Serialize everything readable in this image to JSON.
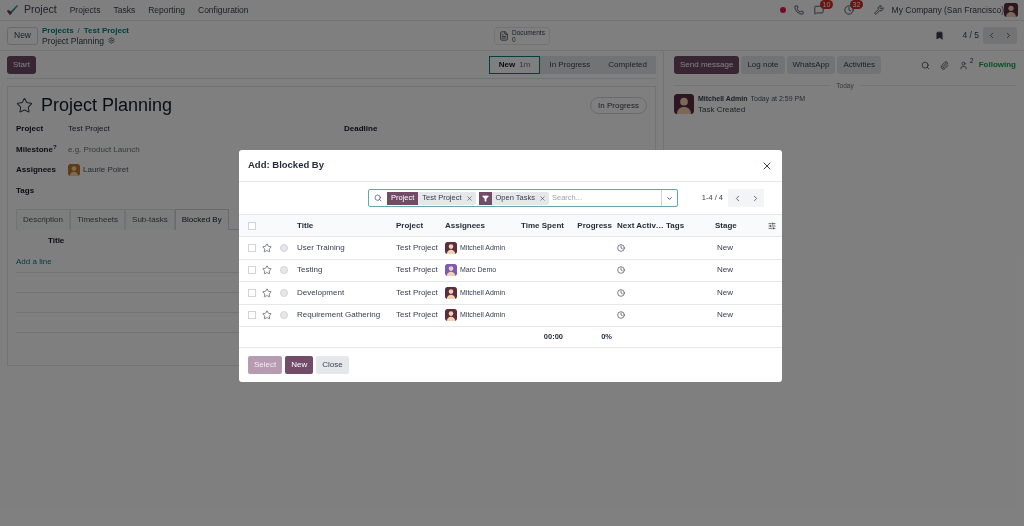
{
  "navbar": {
    "app": "Project",
    "menu": [
      "Projects",
      "Tasks",
      "Reporting",
      "Configuration"
    ],
    "messages_count": "10",
    "activities_count": "32",
    "company": "My Company (San Francisco)"
  },
  "control_panel": {
    "new_button": "New",
    "breadcrumbs": [
      "Projects",
      "Test Project"
    ],
    "separator": "/",
    "record": "Project Planning",
    "documents": {
      "label": "Documents",
      "count": "0"
    },
    "pager": "4 / 5"
  },
  "status_bar": {
    "start": "Start",
    "stages": [
      {
        "label": "New",
        "duration": "1m",
        "selected": true
      },
      {
        "label": "In Progress",
        "selected": false
      },
      {
        "label": "Completed",
        "selected": false
      }
    ]
  },
  "form": {
    "title": "Project Planning",
    "starred": false,
    "state": "In Progress",
    "left_fields": [
      {
        "label": "Project",
        "kind": "text",
        "value": "Test Project"
      },
      {
        "label": "Milestone$^{?}$",
        "kind": "placeholder",
        "placeholder": "e.g. Product Launch"
      },
      {
        "label": "Assignees",
        "kind": "avatar",
        "value": "Laurie Poiret"
      },
      {
        "label": "Tags",
        "kind": "empty"
      }
    ],
    "right_fields": [
      {
        "label": "Deadline"
      }
    ],
    "tabs": [
      {
        "label": "Description",
        "selected": false
      },
      {
        "label": "Timesheets",
        "selected": false
      },
      {
        "label": "Sub-tasks",
        "selected": false
      },
      {
        "label": "Blocked By",
        "selected": true
      }
    ],
    "list_column": "Title",
    "add_line": "Add a line"
  },
  "chatter": {
    "buttons": [
      {
        "label": "Send message",
        "selected": true
      },
      {
        "label": "Log note",
        "selected": false
      },
      {
        "label": "WhatsApp",
        "selected": false
      },
      {
        "label": "Activities",
        "selected": false
      }
    ],
    "followers": "2",
    "following": "Following",
    "date": "Today",
    "message": {
      "author": "Mitchell Admin",
      "time": "Today at 2:59 PM",
      "body": "Task Created"
    }
  },
  "dialog": {
    "title": "Add: Blocked By",
    "facets": [
      {
        "kind": "field",
        "tag": "Project",
        "value": "Test Project"
      },
      {
        "kind": "filter",
        "value": "Open Tasks"
      }
    ],
    "search_placeholder": "Search...",
    "pager": "1-4 / 4",
    "all_selected": false,
    "columns": [
      "Title",
      "Project",
      "Assignees",
      "Time Spent",
      "Progress",
      "Next Activ…",
      "Tags",
      "Stage"
    ],
    "rows": [
      {
        "title": "User Training",
        "project": "Test Project",
        "assignee": "Mitchell Admin",
        "color": "#5b2d3f",
        "stage": "New",
        "selected": false,
        "starred": false
      },
      {
        "title": "Testing",
        "project": "Test Project",
        "assignee": "Marc Demo",
        "color": "#7a5bb5",
        "stage": "New",
        "selected": false,
        "starred": false
      },
      {
        "title": "Development",
        "project": "Test Project",
        "assignee": "Mitchell Admin",
        "color": "#5b2d3f",
        "stage": "New",
        "selected": false,
        "starred": false
      },
      {
        "title": "Requirement Gathering",
        "project": "Test Project",
        "assignee": "Mitchell Admin",
        "color": "#5b2d3f",
        "stage": "New",
        "selected": false,
        "starred": false
      }
    ],
    "totals": {
      "time_spent": "00:00",
      "progress": "0%"
    },
    "buttons": [
      {
        "label": "Select",
        "kind": "primary",
        "disabled": true
      },
      {
        "label": "New",
        "kind": "primary",
        "disabled": false
      },
      {
        "label": "Close",
        "kind": "secondary",
        "disabled": false
      }
    ]
  }
}
